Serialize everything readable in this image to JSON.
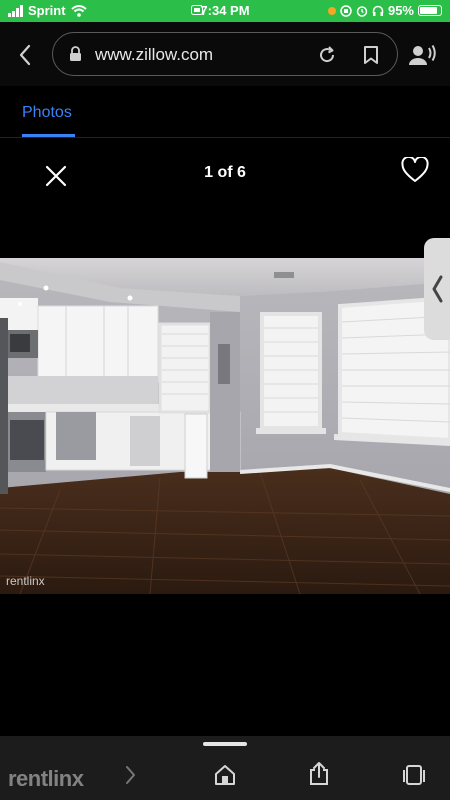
{
  "status_bar": {
    "carrier": "Sprint",
    "time": "7:34 PM",
    "battery": "95%"
  },
  "browser": {
    "url": "www.zillow.com"
  },
  "tabs": {
    "photos_label": "Photos"
  },
  "viewer": {
    "counter": "1 of 6",
    "watermark": "rentlinx"
  },
  "bottom_bar": {
    "watermark": "rentlinx"
  }
}
